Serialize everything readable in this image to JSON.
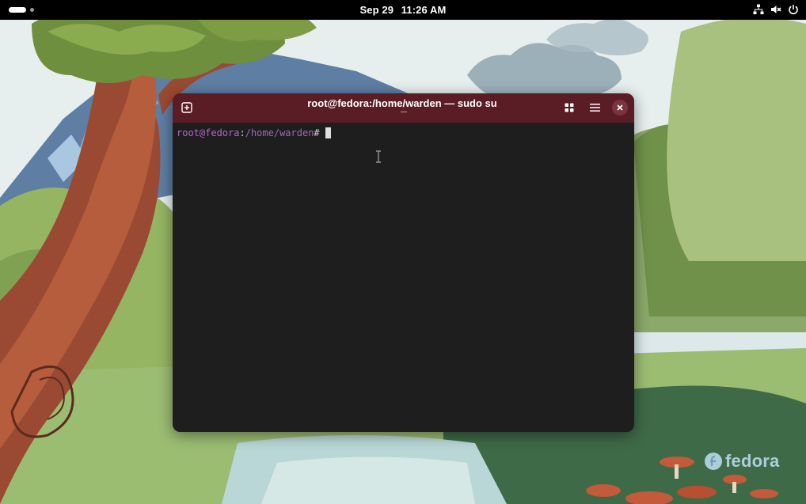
{
  "topbar": {
    "date": "Sep 29",
    "time": "11:26 AM",
    "icons": [
      "network-icon",
      "volume-muted-icon",
      "power-icon"
    ]
  },
  "window": {
    "title": "root@fedora:/home/warden — sudo su",
    "buttons": [
      "new-tab-icon",
      "tab-overview-icon",
      "hamburger-menu-icon",
      "close-icon"
    ]
  },
  "terminal": {
    "prompt_user": "root@fedora",
    "prompt_sep": ":",
    "prompt_path": "/home/warden",
    "prompt_symbol": "#"
  },
  "desktop": {
    "logo_text": "fedora"
  },
  "colors": {
    "headerbar": "#5a1c25",
    "terminal_bg": "#1e1e1e",
    "prompt": "#c061cb"
  }
}
